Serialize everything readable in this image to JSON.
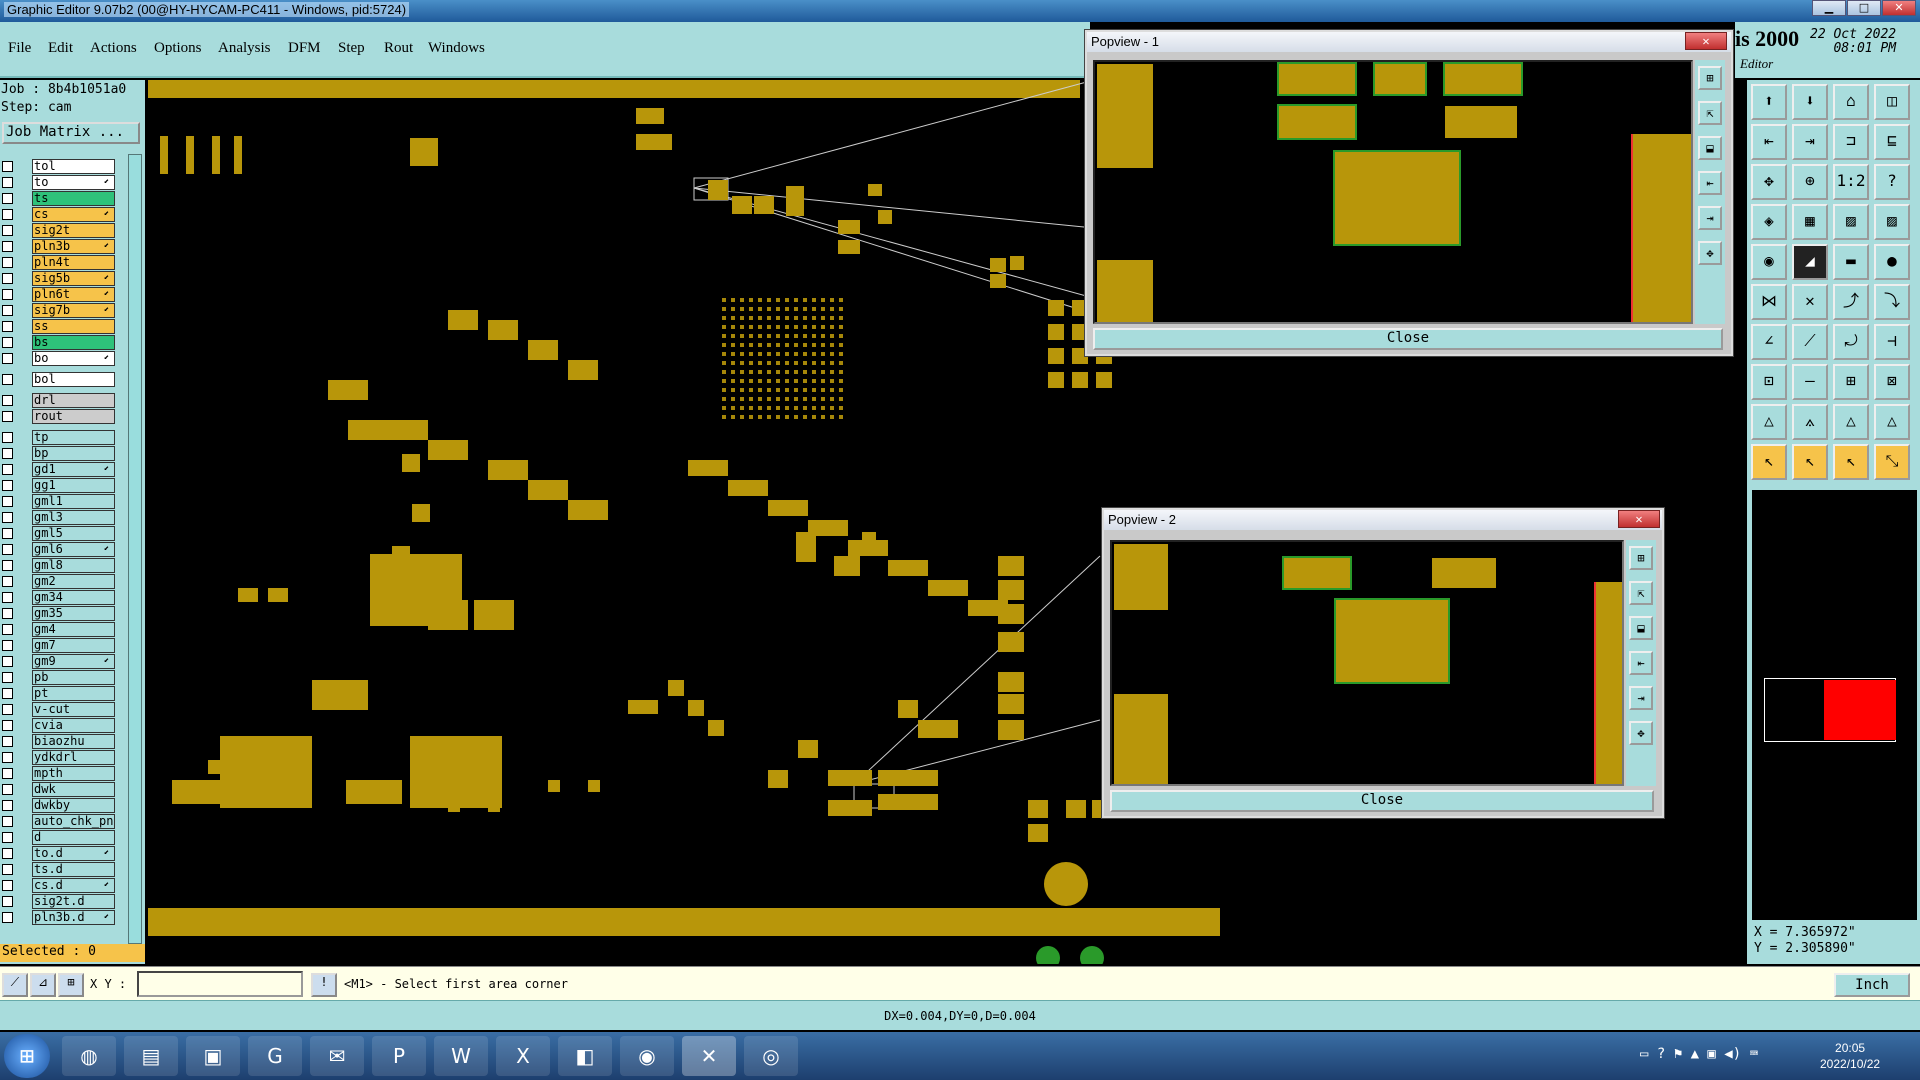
{
  "window": {
    "title": "Graphic Editor 9.07b2 (00@HY-HYCAM-PC411 - Windows, pid:5724)"
  },
  "menu": [
    "File",
    "Edit",
    "Actions",
    "Options",
    "Analysis",
    "DFM",
    "Step",
    "Rout",
    "Windows"
  ],
  "brand": {
    "text": "is 2000",
    "subtitle": "Editor",
    "date": "22 Oct 2022",
    "time": "08:01 PM"
  },
  "job": {
    "job_label": "Job : 8b4b1051a0",
    "step_label": "Step: cam",
    "matrix_button": "Job Matrix ..."
  },
  "layers": [
    {
      "name": "tol",
      "color": "#ffffff",
      "arrow": false
    },
    {
      "name": "to",
      "color": "#ffffff",
      "arrow": true
    },
    {
      "name": "ts",
      "color": "#2ec27a",
      "arrow": false
    },
    {
      "name": "cs",
      "color": "#f6c34a",
      "arrow": true
    },
    {
      "name": "sig2t",
      "color": "#f6c34a",
      "arrow": false
    },
    {
      "name": "pln3b",
      "color": "#f6c34a",
      "arrow": true
    },
    {
      "name": "pln4t",
      "color": "#f6c34a",
      "arrow": false
    },
    {
      "name": "sig5b",
      "color": "#f6c34a",
      "arrow": true
    },
    {
      "name": "pln6t",
      "color": "#f6c34a",
      "arrow": true
    },
    {
      "name": "sig7b",
      "color": "#f6c34a",
      "arrow": true
    },
    {
      "name": "ss",
      "color": "#f6c34a",
      "arrow": false
    },
    {
      "name": "bs",
      "color": "#2ec27a",
      "arrow": false
    },
    {
      "name": "bo",
      "color": "#ffffff",
      "arrow": true
    },
    {
      "name": "",
      "color": "",
      "arrow": false
    },
    {
      "name": "bol",
      "color": "#ffffff",
      "arrow": false
    },
    {
      "name": "",
      "color": "",
      "arrow": false
    },
    {
      "name": "drl",
      "color": "#cccccc",
      "arrow": false
    },
    {
      "name": "rout",
      "color": "#cccccc",
      "arrow": false
    },
    {
      "name": "",
      "color": "",
      "arrow": false
    },
    {
      "name": "tp",
      "color": "#a8dcdc",
      "arrow": false
    },
    {
      "name": "bp",
      "color": "#a8dcdc",
      "arrow": false
    },
    {
      "name": "gd1",
      "color": "#a8dcdc",
      "arrow": true
    },
    {
      "name": "gg1",
      "color": "#a8dcdc",
      "arrow": false
    },
    {
      "name": "gml1",
      "color": "#a8dcdc",
      "arrow": false
    },
    {
      "name": "gml3",
      "color": "#a8dcdc",
      "arrow": false
    },
    {
      "name": "gml5",
      "color": "#a8dcdc",
      "arrow": false
    },
    {
      "name": "gml6",
      "color": "#a8dcdc",
      "arrow": true
    },
    {
      "name": "gml8",
      "color": "#a8dcdc",
      "arrow": false
    },
    {
      "name": "gm2",
      "color": "#a8dcdc",
      "arrow": false
    },
    {
      "name": "gm34",
      "color": "#a8dcdc",
      "arrow": false
    },
    {
      "name": "gm35",
      "color": "#a8dcdc",
      "arrow": false
    },
    {
      "name": "gm4",
      "color": "#a8dcdc",
      "arrow": false
    },
    {
      "name": "gm7",
      "color": "#a8dcdc",
      "arrow": false
    },
    {
      "name": "gm9",
      "color": "#a8dcdc",
      "arrow": true
    },
    {
      "name": "pb",
      "color": "#a8dcdc",
      "arrow": false
    },
    {
      "name": "pt",
      "color": "#a8dcdc",
      "arrow": false
    },
    {
      "name": "v-cut",
      "color": "#a8dcdc",
      "arrow": false
    },
    {
      "name": "cvia",
      "color": "#a8dcdc",
      "arrow": false
    },
    {
      "name": "biaozhu",
      "color": "#a8dcdc",
      "arrow": false
    },
    {
      "name": "ydkdrl",
      "color": "#a8dcdc",
      "arrow": false
    },
    {
      "name": "mpth",
      "color": "#a8dcdc",
      "arrow": false
    },
    {
      "name": "dwk",
      "color": "#a8dcdc",
      "arrow": false
    },
    {
      "name": "dwkby",
      "color": "#a8dcdc",
      "arrow": false
    },
    {
      "name": "auto_chk_pn",
      "color": "#a8dcdc",
      "arrow": false
    },
    {
      "name": "d",
      "color": "#a8dcdc",
      "arrow": false
    },
    {
      "name": "to.d",
      "color": "#a8dcdc",
      "arrow": true
    },
    {
      "name": "ts.d",
      "color": "#a8dcdc",
      "arrow": false
    },
    {
      "name": "cs.d",
      "color": "#a8dcdc",
      "arrow": true
    },
    {
      "name": "sig2t.d",
      "color": "#a8dcdc",
      "arrow": false
    },
    {
      "name": "pln3b.d",
      "color": "#a8dcdc",
      "arrow": true
    }
  ],
  "selected": "Selected : 0",
  "popview1": {
    "title": "Popview - 1",
    "close": "Close"
  },
  "popview2": {
    "title": "Popview - 2",
    "close": "Close"
  },
  "coords": {
    "x": "X = 7.365972\"",
    "y": "Y = 2.305890\""
  },
  "cmd": {
    "xy_label": "X Y :",
    "xy_value": "",
    "prompt": "<M1> - Select first area corner",
    "unit": "Inch"
  },
  "status": "DX=0.004,DY=0,D=0.004",
  "clock": {
    "time": "20:05",
    "date": "2022/10/22"
  },
  "colors": {
    "copper": "#b8960a",
    "panel": "#a8dcdc",
    "highlight": "#f6c34a"
  }
}
